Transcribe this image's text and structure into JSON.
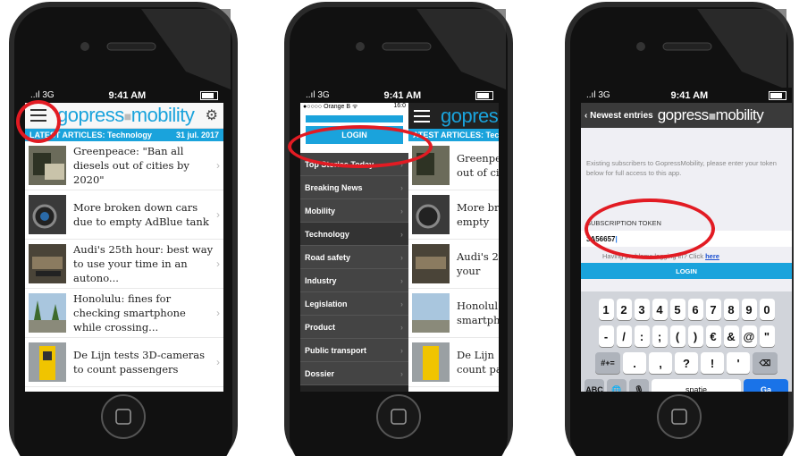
{
  "phone1": {
    "status": {
      "signal": "..ıl 3G",
      "time": "9:41 AM"
    },
    "logo": {
      "brand": "gopress",
      "product": "mobility"
    },
    "latest": {
      "label": "LATEST ARTICLES: Technology",
      "date": "31 jul. 2017"
    },
    "articles": [
      {
        "title": "Greenpeace: \"Ban all diesels out of cities by 2020\""
      },
      {
        "title": "More broken down cars due to empty AdBlue tank"
      },
      {
        "title": "Audi's 25th hour: best way to use your time in an autono..."
      },
      {
        "title": "Honolulu: fines for checking smartphone while crossing..."
      },
      {
        "title": "De Lijn tests 3D-cameras to count passengers"
      }
    ]
  },
  "phone2": {
    "status": {
      "signal": "..ıl 3G",
      "time": "9:41 AM",
      "inner_carrier": "●○○○○ Orange B ᯤ",
      "inner_time": "16:0"
    },
    "login_label": "LOGIN",
    "logo_partial": "gopres",
    "latest_partial": "ATEST ARTICLES: Tec",
    "menu": [
      "Top Stories Today",
      "Breaking News",
      "Mobility",
      "Technology",
      "Road safety",
      "Industry",
      "Legislation",
      "Product",
      "Public transport",
      "Dossier"
    ],
    "article_partials": [
      "Greenpea out of ci",
      "More br to empty",
      "Audi's 2 use your",
      "Honolul smartph",
      "De Lijn count pa"
    ]
  },
  "phone3": {
    "status": {
      "signal": "..ıl 3G",
      "time": "9:41 AM"
    },
    "back_label": "Newest entries",
    "logo": {
      "brand": "gopress",
      "product": "mobility"
    },
    "intro": "Existing subscribers to GopressMobility, please enter your token below for full access to this app.",
    "token_label": "SUBSCRIPTION TOKEN",
    "token_value": "3A56657",
    "problems_text": "Having problems logging in? Click",
    "problems_link": "here",
    "login_label": "LOGIN",
    "keyboard": {
      "row1": [
        "1",
        "2",
        "3",
        "4",
        "5",
        "6",
        "7",
        "8",
        "9",
        "0"
      ],
      "row2": [
        "-",
        "/",
        ":",
        ";",
        "(",
        ")",
        "€",
        "&",
        "@",
        "\""
      ],
      "row3": [
        "#+=",
        ".",
        ",",
        "?",
        "!",
        "'",
        "⌫"
      ],
      "row4": [
        "ABC",
        "🌐",
        "🎙",
        "spatie",
        "Ga"
      ]
    }
  }
}
